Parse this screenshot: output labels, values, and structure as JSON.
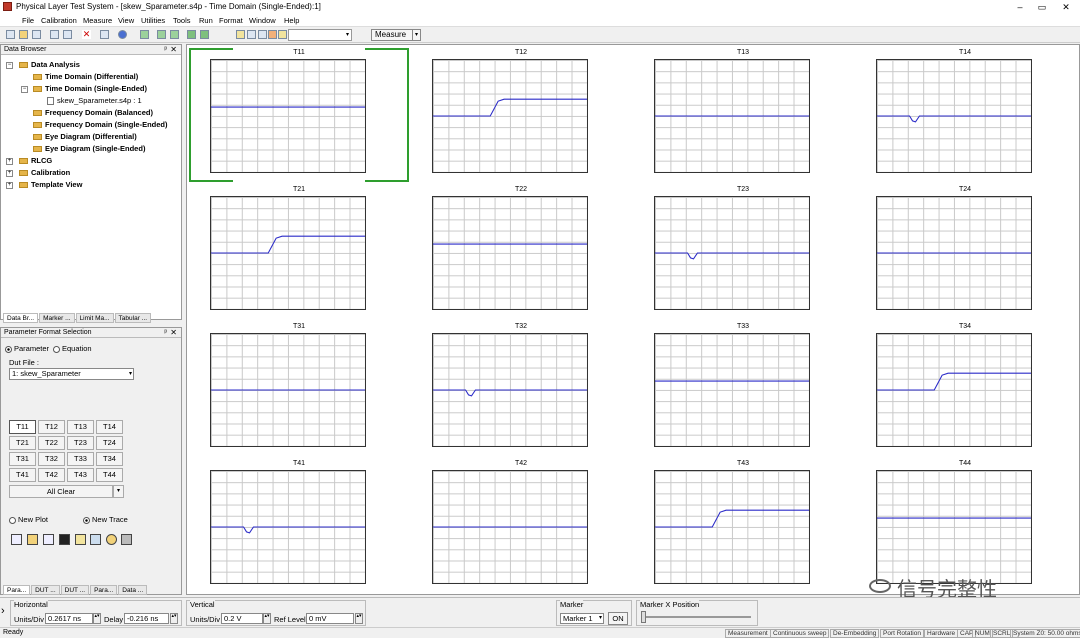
{
  "window": {
    "title": "Physical Layer Test System - [skew_Sparameter.s4p - Time Domain (Single-Ended):1]",
    "controls": [
      "–",
      "▭",
      "✕"
    ]
  },
  "menu": [
    "File",
    "Calibration",
    "Measure",
    "View",
    "Utilities",
    "Tools",
    "Run",
    "Format",
    "Window",
    "Help"
  ],
  "toolbar": {
    "measure_label": "Measure"
  },
  "data_browser": {
    "header": "Data Browser",
    "items": [
      {
        "label": "Data Analysis",
        "bold": true
      },
      {
        "label": "Time Domain (Differential)",
        "bold": true
      },
      {
        "label": "Time Domain (Single-Ended)",
        "bold": true
      },
      {
        "label": "skew_Sparameter.s4p : 1",
        "bold": false
      },
      {
        "label": "Frequency Domain (Balanced)",
        "bold": true
      },
      {
        "label": "Frequency Domain (Single-Ended)",
        "bold": true
      },
      {
        "label": "Eye Diagram (Differential)",
        "bold": true
      },
      {
        "label": "Eye Diagram (Single-Ended)",
        "bold": true
      },
      {
        "label": "RLCG",
        "bold": true
      },
      {
        "label": "Calibration",
        "bold": true
      },
      {
        "label": "Template View",
        "bold": true
      }
    ],
    "tabs": [
      "Data Br...",
      "Marker ...",
      "Limit Ma...",
      "Tabular ..."
    ]
  },
  "param_panel": {
    "header": "Parameter Format Selection",
    "radio_parameter": "Parameter",
    "radio_equation": "Equation",
    "dut_label": "Dut File :",
    "dut_value": "1:  skew_Sparameter",
    "buttons": [
      "T11",
      "T12",
      "T13",
      "T14",
      "T21",
      "T22",
      "T23",
      "T24",
      "T31",
      "T32",
      "T33",
      "T34",
      "T41",
      "T42",
      "T43",
      "T44"
    ],
    "all_clear": "All Clear",
    "new_plot": "New Plot",
    "new_trace": "New Trace",
    "tabs": [
      "Para...",
      "DUT ...",
      "DUT ...",
      "Para...",
      "Data ..."
    ]
  },
  "plots": [
    {
      "title": "T11",
      "shape": "flat",
      "level": 0.42
    },
    {
      "title": "T12",
      "shape": "step-up",
      "level": 0.42
    },
    {
      "title": "T13",
      "shape": "flat",
      "level": 0.5
    },
    {
      "title": "T14",
      "shape": "dip",
      "level": 0.5
    },
    {
      "title": "T21",
      "shape": "step-up",
      "level": 0.42
    },
    {
      "title": "T22",
      "shape": "flat",
      "level": 0.42
    },
    {
      "title": "T23",
      "shape": "dip",
      "level": 0.5
    },
    {
      "title": "T24",
      "shape": "flat",
      "level": 0.5
    },
    {
      "title": "T31",
      "shape": "flat",
      "level": 0.5
    },
    {
      "title": "T32",
      "shape": "dip",
      "level": 0.5
    },
    {
      "title": "T33",
      "shape": "flat",
      "level": 0.42
    },
    {
      "title": "T34",
      "shape": "step-up",
      "level": 0.42
    },
    {
      "title": "T41",
      "shape": "dip",
      "level": 0.5
    },
    {
      "title": "T42",
      "shape": "flat",
      "level": 0.5
    },
    {
      "title": "T43",
      "shape": "step-up",
      "level": 0.42
    },
    {
      "title": "T44",
      "shape": "flat",
      "level": 0.42
    }
  ],
  "controls": {
    "horizontal": {
      "label": "Horizontal",
      "units_label": "Units/Div",
      "units_value": "0.2617 ns",
      "delay_label": "Delay",
      "delay_value": "-0.216 ns"
    },
    "vertical": {
      "label": "Vertical",
      "units_label": "Units/Div",
      "units_value": "0.2 V",
      "ref_label": "Ref Level",
      "ref_value": "0 mV"
    },
    "marker": {
      "label": "Marker",
      "select": "Marker 1",
      "on_btn": "ON"
    },
    "marker_x": {
      "label": "Marker X Position"
    }
  },
  "status": {
    "left": "Ready",
    "cells": [
      "Measurement",
      "Continuous sweep",
      "De-Embedding",
      "Port Rotation",
      "Hardware",
      "CAP",
      "NUM",
      "SCRL",
      "System Z0: 50.00 ohms"
    ]
  },
  "watermark": "信号完整性",
  "colors": {
    "trace": "#2b2bc8",
    "selected": "#2e9e2e"
  }
}
